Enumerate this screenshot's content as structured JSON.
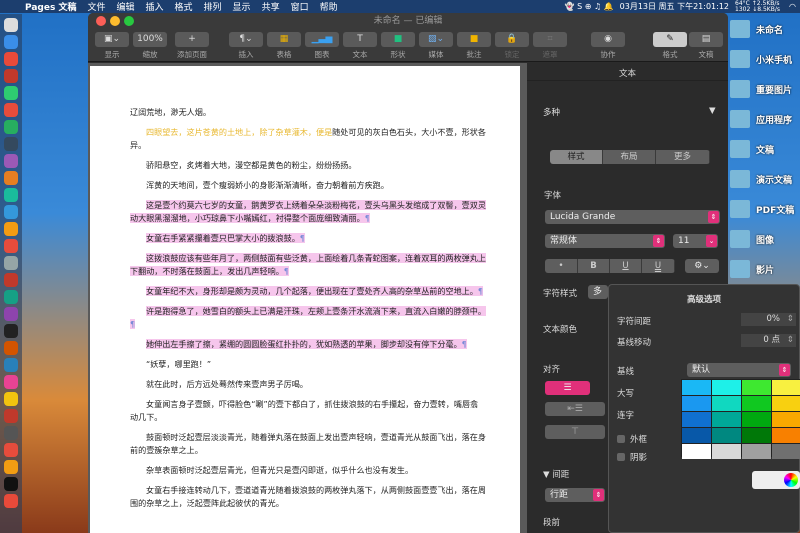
{
  "menubar": {
    "apple": "",
    "app": "Pages 文稿",
    "items": [
      "文件",
      "编辑",
      "插入",
      "格式",
      "排列",
      "显示",
      "共享",
      "窗口",
      "帮助"
    ],
    "datetime": "03月13日 周五 下午21:01:12",
    "stats": "64°C ↑2.5KB/s 1302 ↓8.5KB/s"
  },
  "desktop": [
    "未命名",
    "小米手机",
    "重要图片",
    "应用程序",
    "文稿",
    "演示文稿",
    "PDF文稿",
    "图像",
    "影片"
  ],
  "window": {
    "title": "未命名 — 已编辑"
  },
  "toolbar": {
    "view": "显示",
    "zoom_value": "100%",
    "zoom": "缩放",
    "add_page": "添加页面",
    "insert": "插入",
    "table": "表格",
    "chart": "图表",
    "text": "文本",
    "shape": "形状",
    "media": "媒体",
    "comment": "批注",
    "lock": "锁定",
    "mask": "遮罩",
    "collab": "协作",
    "format": "格式",
    "document": "文稿"
  },
  "document": {
    "paragraphs": [
      {
        "text": "辽阔荒地，渺无人烟。",
        "style": "noind"
      },
      {
        "yellow": "四眼望去，这片苍黄的土地上，除了杂草灌木，便是",
        "text": "随处可见的灰白色石头，大小不壹，形状各异。"
      },
      {
        "text": "骄阳悬空，炙烤着大地，漫空都是黄色的粉尘，纷纷扬扬。"
      },
      {
        "text": "浑黄的天地间，壹个瘦弱娇小的身影渐渐清晰，奋力朝着前方疾跑。"
      },
      {
        "text": "这是壹个约莫六七岁的女童，鹅黄罗衣上绣着朵朵淡粉梅花，壹头乌黑头发绾成了双髻，壹双灵动大眼黑溜溜地，小巧琼鼻下小嘴嫣红，衬得整个面庞细致清丽。",
        "style": "hl"
      },
      {
        "text": "女童右手紧紧攥着壹只巴掌大小的拨浪鼓。",
        "style": "hl"
      },
      {
        "text": "这拨浪鼓应该有些年月了，两侧鼓面有些泛黄，上面绘着几条青蛇图案，连着双耳的两枚弹丸上下翻动，不时落在鼓面上，发出几声轻响。",
        "style": "hl"
      },
      {
        "text": "女童年纪不大，身形却是颇为灵动，几个起落，便出现在了壹处齐人高的杂草丛前的空地上。",
        "style": "hl"
      },
      {
        "text": "许是跑得急了，她雪白的额头上已满是汗珠，左颊上壹条汗水流淌下来，直流入白嫩的脖颈中。",
        "style": "hl"
      },
      {
        "text": "她伸出左手擦了擦，紧绷的圆圆脸蛋红扑扑的，犹如熟透的苹果，脚步却没有停下分毫。",
        "style": "hl"
      },
      {
        "text": "“妖孽，哪里跑！”"
      },
      {
        "text": "就在此时，后方远处蓦然传来壹声男子厉喝。"
      },
      {
        "text": "女童闻言身子壹颤，吓得脸色“唰”的壹下都白了，抓住拨浪鼓的右手攥起，奋力壹转，嘴唇翕动几下。"
      },
      {
        "text": "鼓面顿时泛起壹层淡淡青光，随着弹丸落在鼓面上发出壹声轻响，壹道青光从鼓面飞出，落在身前的壹簇杂草之上。"
      },
      {
        "text": "杂草表面顿时泛起壹层青光，但青光只是壹闪即逝，似乎什么也没有发生。"
      },
      {
        "text": "女童右手接连转动几下，壹道道青光随着拨浪鼓的两枚弹丸落下，从两侧鼓面壹壹飞出，落在周围的杂草之上，泛起壹阵此起彼伏的青光。"
      }
    ],
    "pilcrow": "¶"
  },
  "sidebar": {
    "header": "文本",
    "style_name": "多种",
    "tabs": [
      "样式",
      "布局",
      "更多"
    ],
    "font_label": "字体",
    "font": "Lucida Grande",
    "typeface": "常规体",
    "size": "11",
    "format_buttons": [
      "•",
      "B",
      "U",
      "U"
    ],
    "char_style_label": "字符样式",
    "char_style_value": "多",
    "text_color_label": "文本颜色",
    "align_label": "对齐",
    "spacing_label": "间距",
    "line_spacing": "行距",
    "before_para": "段前"
  },
  "advanced": {
    "title": "高级选项",
    "char_spacing_label": "字符间距",
    "char_spacing": "0%",
    "baseline_shift_label": "基线移动",
    "baseline_shift": "0 点",
    "baseline_label": "基线",
    "baseline_value": "默认",
    "caps_label": "大写",
    "ligature_label": "连字",
    "outline_label": "外框",
    "shadow_label": "阴影"
  },
  "colors": {
    "accent": "#e0307a",
    "grid": [
      "#1ab8f5",
      "#1ef0e8",
      "#3ee830",
      "#f8f040",
      "#1a98f0",
      "#10d8c0",
      "#10c820",
      "#f8d010",
      "#1070d0",
      "#00a898",
      "#00a810",
      "#f8a800",
      "#0858a8",
      "#008880",
      "#007808",
      "#f88000",
      "#ffffff",
      "#d8d8d8",
      "#a0a0a0",
      "#707070"
    ]
  }
}
